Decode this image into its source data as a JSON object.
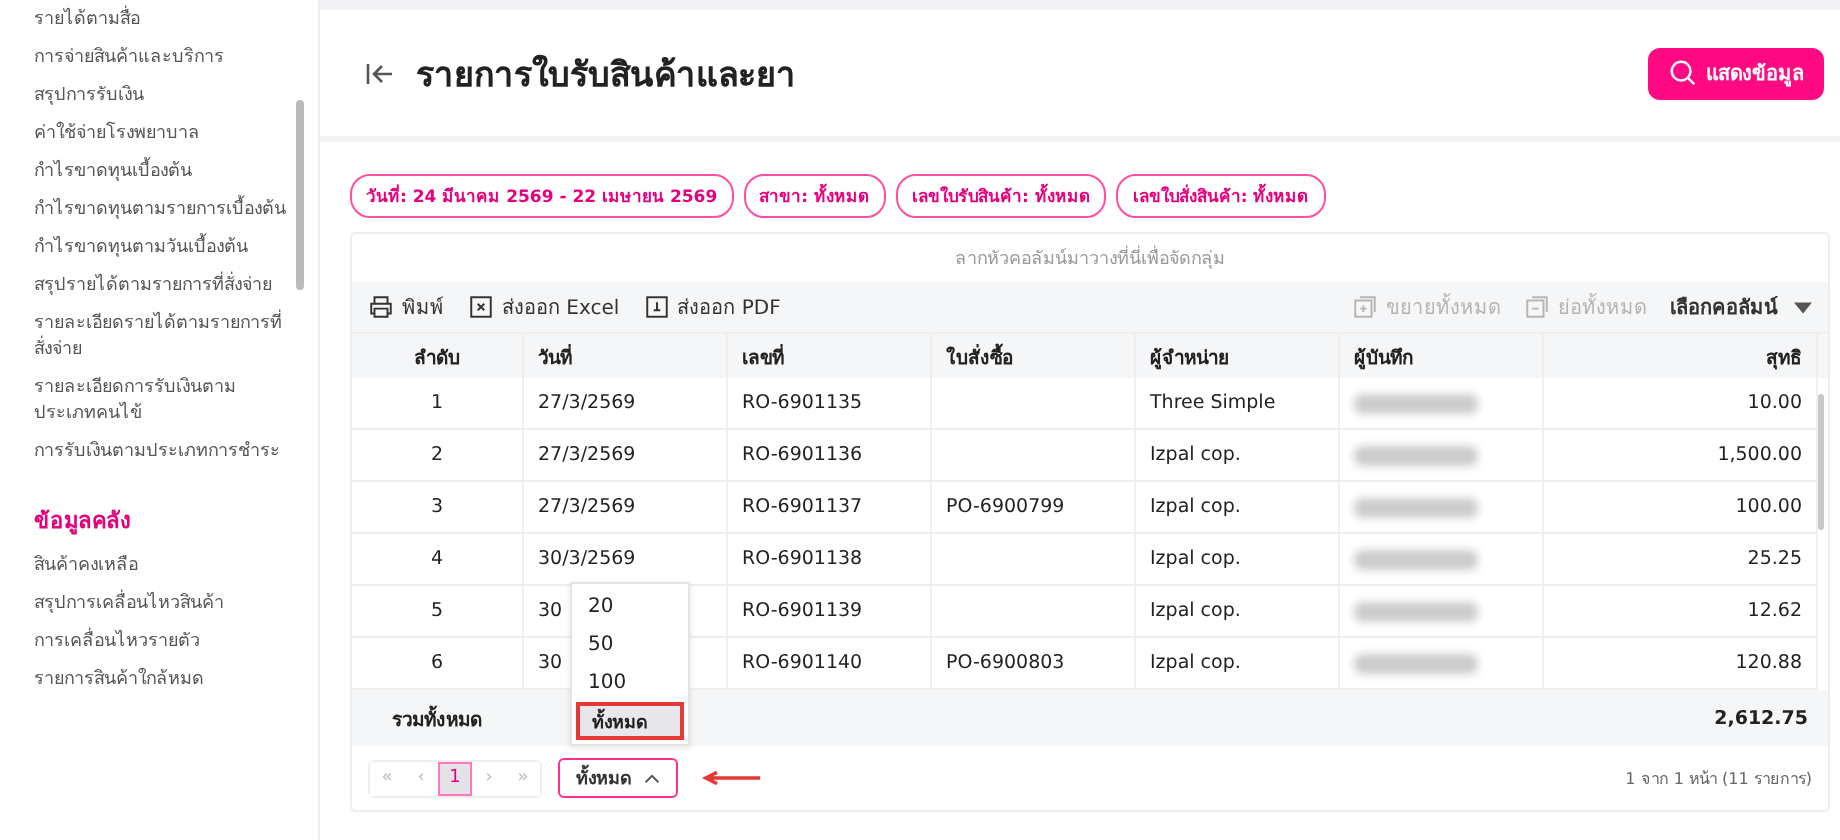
{
  "sidebar": {
    "groups": [
      {
        "items": [
          "รายได้ตามสื่อ",
          "การจ่ายสินค้าและบริการ",
          "สรุปการรับเงิน",
          "ค่าใช้จ่ายโรงพยาบาล",
          "กำไรขาดทุนเบื้องต้น",
          "กำไรขาดทุนตามรายการเบื้องต้น",
          "กำไรขาดทุนตามวันเบื้องต้น",
          "สรุปรายได้ตามรายการที่สั่งจ่าย",
          "รายละเอียดรายได้ตามรายการที่สั่งจ่าย",
          "รายละเอียดการรับเงินตามประเภทคนไข้",
          "การรับเงินตามประเภทการชำระ"
        ]
      },
      {
        "title": "ข้อมูลคลัง",
        "items": [
          "สินค้าคงเหลือ",
          "สรุปการเคลื่อนไหวสินค้า",
          "การเคลื่อนไหวรายตัว",
          "รายการสินค้าใกล้หมด"
        ]
      }
    ]
  },
  "header": {
    "title": "รายการใบรับสินค้าและยา",
    "show_button": "แสดงข้อมูล"
  },
  "filters": [
    "วันที่: 24 มีนาคม 2569 - 22 เมษายน 2569",
    "สาขา: ทั้งหมด",
    "เลขใบรับสินค้า: ทั้งหมด",
    "เลขใบสั่งสินค้า: ทั้งหมด"
  ],
  "table": {
    "group_hint": "ลากหัวคอลัมน์มาวางที่นี่เพื่อจัดกลุ่ม",
    "toolbar": [
      {
        "kind": "print",
        "label": "พิมพ์",
        "disabled": false
      },
      {
        "kind": "excel",
        "label": "ส่งออก Excel",
        "disabled": false
      },
      {
        "kind": "pdf",
        "label": "ส่งออก PDF",
        "disabled": false
      },
      {
        "kind": "expand",
        "label": "ขยายทั้งหมด",
        "disabled": true
      },
      {
        "kind": "collapse",
        "label": "ย่อทั้งหมด",
        "disabled": true
      },
      {
        "kind": "columns",
        "label": "เลือกคอลัมน์",
        "disabled": false
      }
    ],
    "columns": [
      "ลำดับ",
      "วันที่",
      "เลขที่",
      "ใบสั่งซื้อ",
      "ผู้จำหน่าย",
      "ผู้บันทึก",
      "สุทธิ"
    ],
    "rows": [
      {
        "no": "1",
        "date": "27/3/2569",
        "doc": "RO-6901135",
        "po": "",
        "vendor": "Three Simple",
        "net": "10.00"
      },
      {
        "no": "2",
        "date": "27/3/2569",
        "doc": "RO-6901136",
        "po": "",
        "vendor": "Izpal cop.",
        "net": "1,500.00"
      },
      {
        "no": "3",
        "date": "27/3/2569",
        "doc": "RO-6901137",
        "po": "PO-6900799",
        "vendor": "Izpal cop.",
        "net": "100.00"
      },
      {
        "no": "4",
        "date": "30/3/2569",
        "doc": "RO-6901138",
        "po": "",
        "vendor": "Izpal cop.",
        "net": "25.25"
      },
      {
        "no": "5",
        "date": "30",
        "doc": "RO-6901139",
        "po": "",
        "vendor": "Izpal cop.",
        "net": "12.62"
      },
      {
        "no": "6",
        "date": "30",
        "doc": "RO-6901140",
        "po": "PO-6900803",
        "vendor": "Izpal cop.",
        "net": "120.88"
      }
    ],
    "total_label": "รวมทั้งหมด",
    "total": "2,612.75"
  },
  "pager": {
    "buttons": [
      {
        "label": "«",
        "selected": false
      },
      {
        "label": "‹",
        "selected": false
      },
      {
        "label": "1",
        "selected": true
      },
      {
        "label": "›",
        "selected": false
      },
      {
        "label": "»",
        "selected": false
      }
    ],
    "page_size": {
      "value": "ทั้งหมด",
      "expanded": true,
      "options": [
        {
          "label": "20",
          "selected": false
        },
        {
          "label": "50",
          "selected": false
        },
        {
          "label": "100",
          "selected": false
        },
        {
          "label": "ทั้งหมด",
          "selected": true
        }
      ]
    },
    "summary": "1 จาก 1 หน้า (11 รายการ)"
  }
}
